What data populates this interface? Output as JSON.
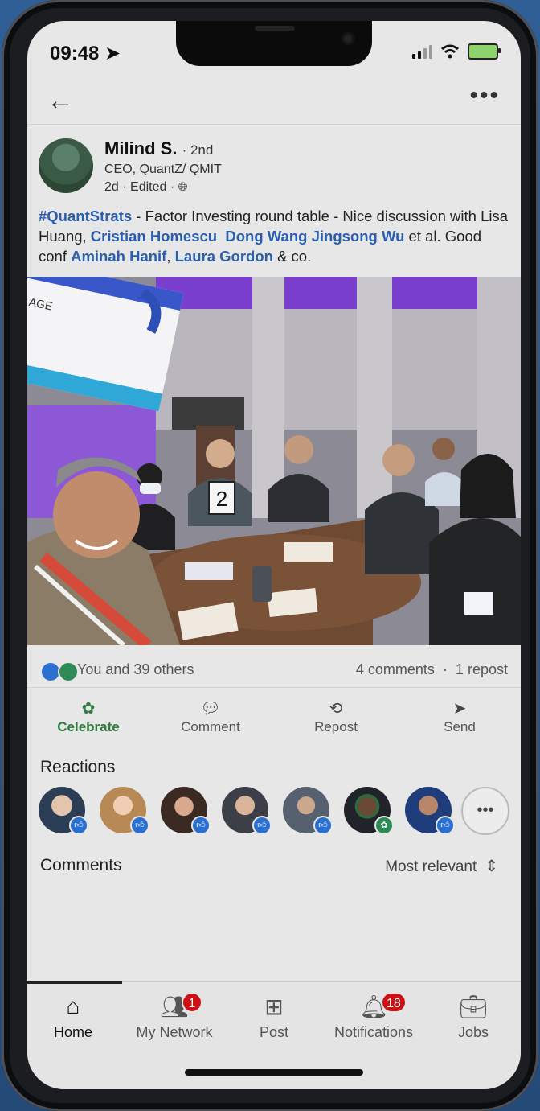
{
  "status_bar": {
    "time": "09:48 ➤"
  },
  "post": {
    "author_name": "Milind S.",
    "degree": "· 2nd",
    "author_title": "CEO, QuantZ/ QMIT",
    "meta": "2d · Edited ·",
    "text": {
      "hashtag": "#QuantStrats",
      "part1": " - Factor Investing round table - Nice discussion with Lisa Huang, ",
      "mention1": "Cristian Homescu",
      "mention2": "Dong Wang",
      "mention3": "Jingsong Wu",
      "part2": " et al. Good conf ",
      "mention4": "Aminah Hanif",
      "sep": ", ",
      "mention5": "Laura Gordon",
      "part3": " & co."
    },
    "photo_signs": {
      "screen_text": "AGE",
      "table_number": "2"
    }
  },
  "engagement": {
    "likes_text": "You and 39 others",
    "comments_text": "4 comments",
    "dot": "·",
    "reposts_text": "1 repost"
  },
  "actions": [
    {
      "label": "Celebrate"
    },
    {
      "label": "Comment"
    },
    {
      "label": "Repost"
    },
    {
      "label": "Send"
    }
  ],
  "reactions_title": "Reactions",
  "comments_title": "Comments",
  "sort_label": "Most relevant",
  "nav": [
    {
      "label": "Home"
    },
    {
      "label": "My Network",
      "badge": "1"
    },
    {
      "label": "Post"
    },
    {
      "label": "Notifications",
      "badge": "18"
    },
    {
      "label": "Jobs"
    }
  ],
  "colors": {
    "link": "#2a5fae",
    "celebrate": "#2f7a3f",
    "badge": "#cc1016",
    "like": "#2b6fd1"
  }
}
